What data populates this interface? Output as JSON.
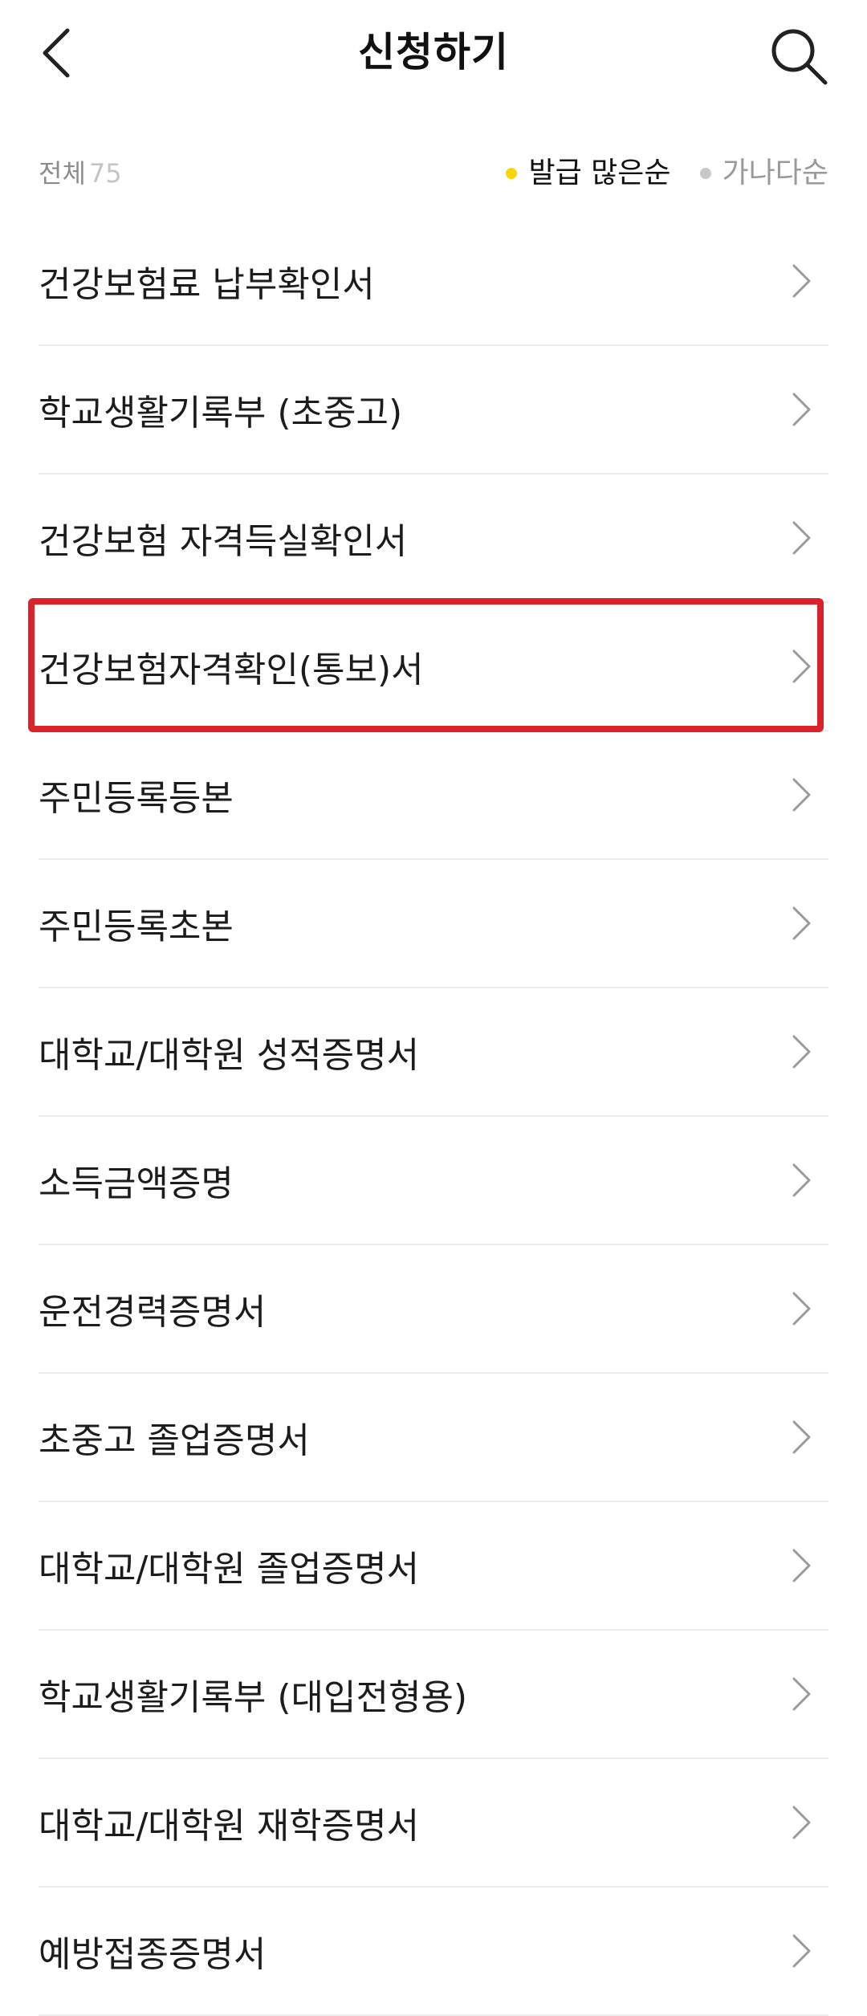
{
  "header": {
    "title": "신청하기",
    "back_icon": "chevron-left-icon",
    "search_icon": "search-icon"
  },
  "filter": {
    "total_label": "전체",
    "total_count": "75",
    "sort_options": [
      {
        "label": "발급 많은순",
        "active": true,
        "dot_color": "#f5d70a"
      },
      {
        "label": "가나다순",
        "active": false,
        "dot_color": "#c8c8c8"
      }
    ]
  },
  "items": [
    {
      "label": "건강보험료 납부확인서"
    },
    {
      "label": "학교생활기록부 (초중고)"
    },
    {
      "label": "건강보험 자격득실확인서"
    },
    {
      "label": "건강보험자격확인(통보)서",
      "highlighted": true
    },
    {
      "label": "주민등록등본"
    },
    {
      "label": "주민등록초본"
    },
    {
      "label": "대학교/대학원 성적증명서"
    },
    {
      "label": "소득금액증명"
    },
    {
      "label": "운전경력증명서"
    },
    {
      "label": "초중고 졸업증명서"
    },
    {
      "label": "대학교/대학원 졸업증명서"
    },
    {
      "label": "학교생활기록부 (대입전형용)"
    },
    {
      "label": "대학교/대학원 재학증명서"
    },
    {
      "label": "예방접종증명서"
    }
  ],
  "colors": {
    "highlight_border": "#d9222a",
    "active_sort_text": "#111111",
    "inactive_sort_text": "#9a9a9a"
  }
}
